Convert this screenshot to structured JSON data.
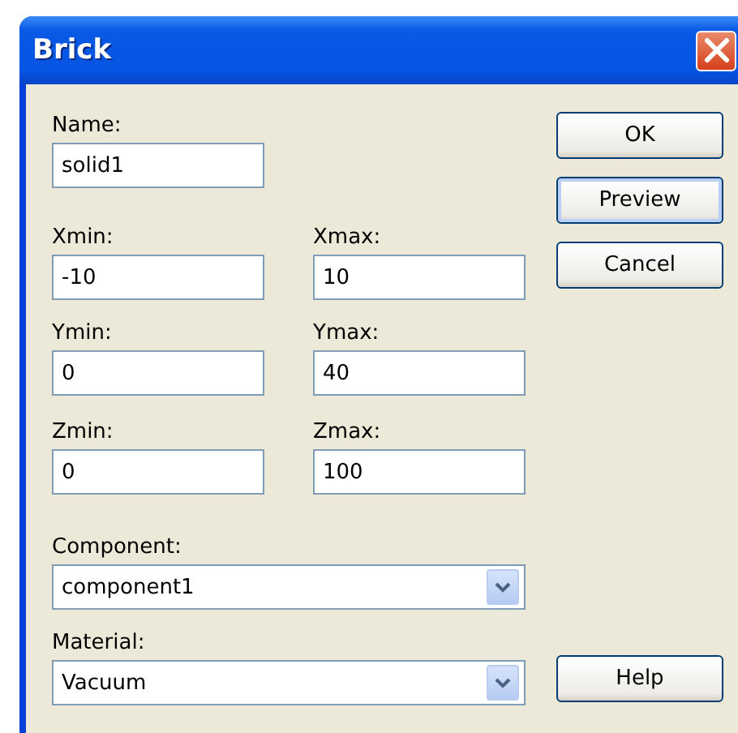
{
  "window": {
    "title": "Brick"
  },
  "name": {
    "label": "Name:",
    "value": "solid1"
  },
  "bounds": [
    {
      "label": "Xmin:",
      "value": "-10"
    },
    {
      "label": "Xmax:",
      "value": "10"
    },
    {
      "label": "Ymin:",
      "value": "0"
    },
    {
      "label": "Ymax:",
      "value": "40"
    },
    {
      "label": "Zmin:",
      "value": "0"
    },
    {
      "label": "Zmax:",
      "value": "100"
    }
  ],
  "component": {
    "label": "Component:",
    "value": "component1"
  },
  "material": {
    "label": "Material:",
    "value": "Vacuum"
  },
  "buttons": [
    {
      "label": "OK",
      "focused": false
    },
    {
      "label": "Preview",
      "focused": true
    },
    {
      "label": "Cancel",
      "focused": false
    }
  ],
  "help_button": {
    "label": "Help",
    "focused": false
  }
}
